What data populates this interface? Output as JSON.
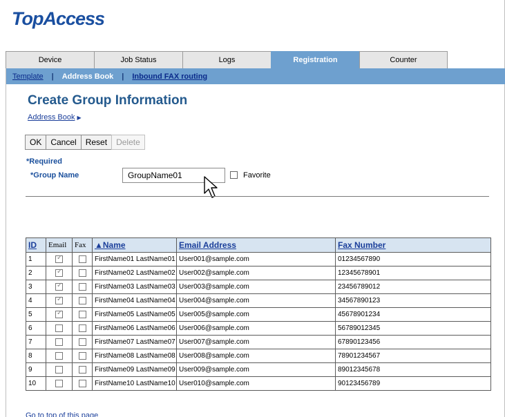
{
  "app": {
    "logo_text": "TopAccess"
  },
  "tabs": [
    {
      "label": "Device",
      "active": false
    },
    {
      "label": "Job Status",
      "active": false
    },
    {
      "label": "Logs",
      "active": false
    },
    {
      "label": "Registration",
      "active": true
    },
    {
      "label": "Counter",
      "active": false
    }
  ],
  "subnav": {
    "items": [
      {
        "label": "Template",
        "current": false
      },
      {
        "label": "Address Book",
        "current": true
      },
      {
        "label": "Inbound FAX routing",
        "current": false
      }
    ],
    "separator": "|"
  },
  "page": {
    "title": "Create Group Information",
    "breadcrumb": "Address Book",
    "breadcrumb_arrow": "▶"
  },
  "buttons": {
    "ok": "OK",
    "cancel": "Cancel",
    "reset": "Reset",
    "delete": "Delete"
  },
  "form": {
    "required_note": "*Required",
    "group_name_label": "*Group Name",
    "group_name_value": "GroupName01",
    "favorite_label": "Favorite",
    "favorite_checked": false
  },
  "table": {
    "headers": {
      "id": "ID",
      "email": "Email",
      "fax": "Fax",
      "name": "▲Name",
      "email_address": "Email Address",
      "fax_number": "Fax Number"
    },
    "rows": [
      {
        "id": "1",
        "email_checked": true,
        "fax_checked": false,
        "name": "FirstName01 LastName01",
        "email_address": "User001@sample.com",
        "fax_number": "01234567890"
      },
      {
        "id": "2",
        "email_checked": true,
        "fax_checked": false,
        "name": "FirstName02 LastName02",
        "email_address": "User002@sample.com",
        "fax_number": "12345678901"
      },
      {
        "id": "3",
        "email_checked": true,
        "fax_checked": false,
        "name": "FirstName03 LastName03",
        "email_address": "User003@sample.com",
        "fax_number": "23456789012"
      },
      {
        "id": "4",
        "email_checked": true,
        "fax_checked": false,
        "name": "FirstName04 LastName04",
        "email_address": "User004@sample.com",
        "fax_number": "34567890123"
      },
      {
        "id": "5",
        "email_checked": true,
        "fax_checked": false,
        "name": "FirstName05 LastName05",
        "email_address": "User005@sample.com",
        "fax_number": "45678901234"
      },
      {
        "id": "6",
        "email_checked": false,
        "fax_checked": false,
        "name": "FirstName06 LastName06",
        "email_address": "User006@sample.com",
        "fax_number": "56789012345"
      },
      {
        "id": "7",
        "email_checked": false,
        "fax_checked": false,
        "name": "FirstName07 LastName07",
        "email_address": "User007@sample.com",
        "fax_number": "67890123456"
      },
      {
        "id": "8",
        "email_checked": false,
        "fax_checked": false,
        "name": "FirstName08 LastName08",
        "email_address": "User008@sample.com",
        "fax_number": "78901234567"
      },
      {
        "id": "9",
        "email_checked": false,
        "fax_checked": false,
        "name": "FirstName09 LastName09",
        "email_address": "User009@sample.com",
        "fax_number": "89012345678"
      },
      {
        "id": "10",
        "email_checked": false,
        "fax_checked": false,
        "name": "FirstName10 LastName10",
        "email_address": "User010@sample.com",
        "fax_number": "90123456789"
      }
    ]
  },
  "footer": {
    "goto_top": "Go to top of this page"
  },
  "colors": {
    "tab_active": "#6ea0cf",
    "subnav_bg": "#6ea0cf",
    "title": "#245a8e",
    "link": "#1a3e9a",
    "table_header_bg": "#d7e4f1"
  },
  "icons": {
    "cursor": "mouse-pointer-icon",
    "breadcrumb_arrow": "triangle-right-icon"
  }
}
